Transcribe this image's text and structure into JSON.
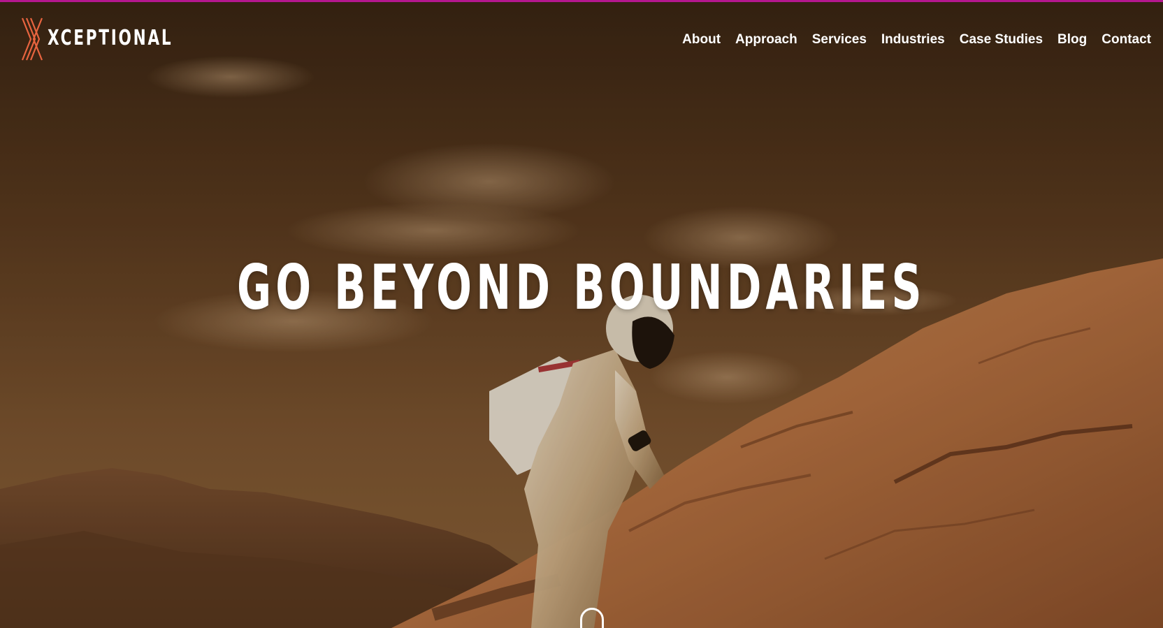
{
  "colors": {
    "top_accent": "#b5178e",
    "logo_accent": "#e8643f",
    "nav_text": "#ffffff",
    "headline_text": "#ffffff",
    "sky_tone": "#6b4323",
    "rock_tone": "#b8743f"
  },
  "header": {
    "logo": {
      "mark_icon": "x-logo-mark-icon",
      "text": "XCEPTIONAL"
    },
    "nav": [
      {
        "label": "About"
      },
      {
        "label": "Approach"
      },
      {
        "label": "Services"
      },
      {
        "label": "Industries"
      },
      {
        "label": "Case Studies"
      },
      {
        "label": "Blog"
      },
      {
        "label": "Contact"
      }
    ]
  },
  "hero": {
    "headline": "GO BEYOND BOUNDARIES",
    "background_image": "astronaut climbing a rocky desert slope under a cloudy sepia sky",
    "scroll_icon": "mouse-scroll-icon"
  }
}
